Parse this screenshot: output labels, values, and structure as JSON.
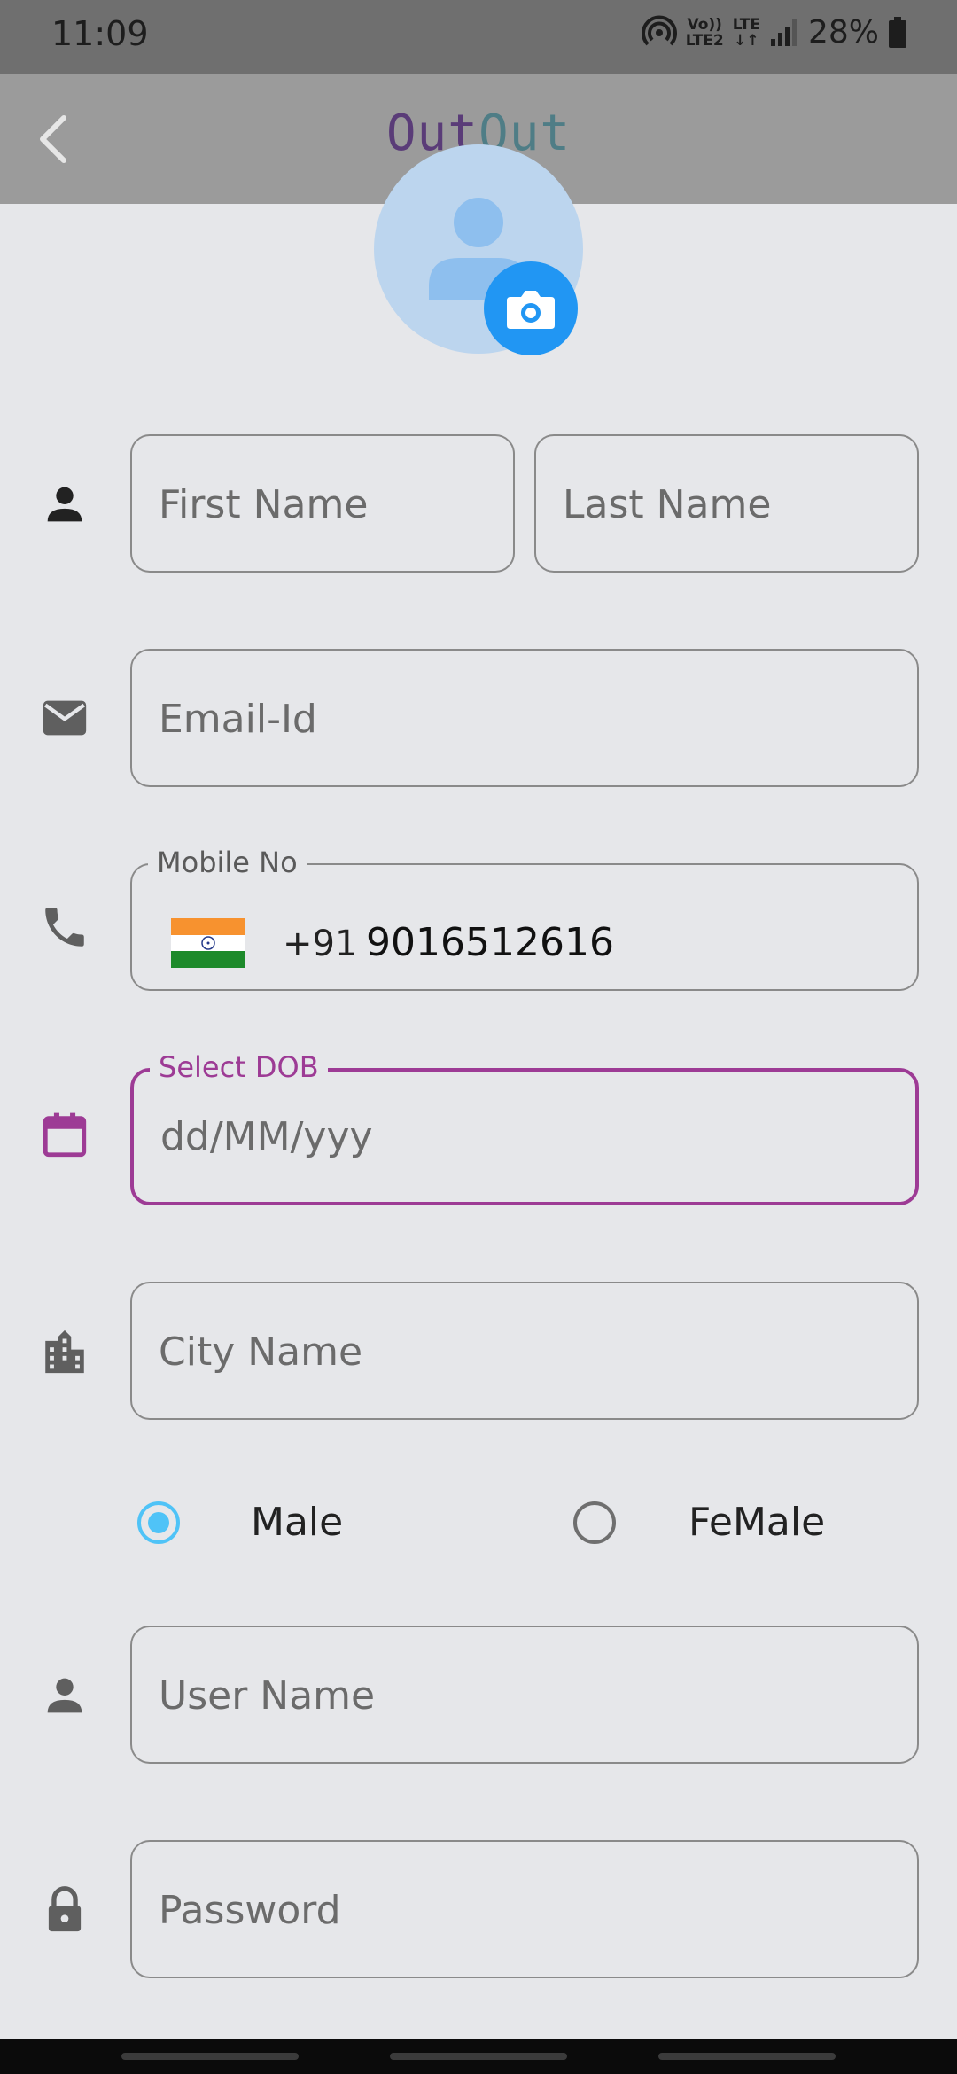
{
  "status_bar": {
    "time": "11:09",
    "network_top": "Vo))",
    "network_bottom": "LTE2",
    "lte_label": "LTE",
    "battery": "28%"
  },
  "app_bar": {
    "back_icon": "chevron-left-icon",
    "title_part1": "Out",
    "title_part2": "Out"
  },
  "form": {
    "first_name_placeholder": "First Name",
    "last_name_placeholder": "Last Name",
    "email_placeholder": "Email-Id",
    "mobile_label": "Mobile No",
    "country_code": "+91",
    "mobile_value": "9016512616",
    "dob_label": "Select DOB",
    "dob_placeholder": "dd/MM/yyy",
    "city_placeholder": "City Name",
    "gender": {
      "options": [
        "Male",
        "FeMale"
      ],
      "selected": "Male"
    },
    "username_placeholder": "User Name",
    "password_placeholder": "Password"
  },
  "colors": {
    "accent_focus": "#9d3b95",
    "radio_selected": "#4fc3f7",
    "camera_button": "#2196f3"
  }
}
